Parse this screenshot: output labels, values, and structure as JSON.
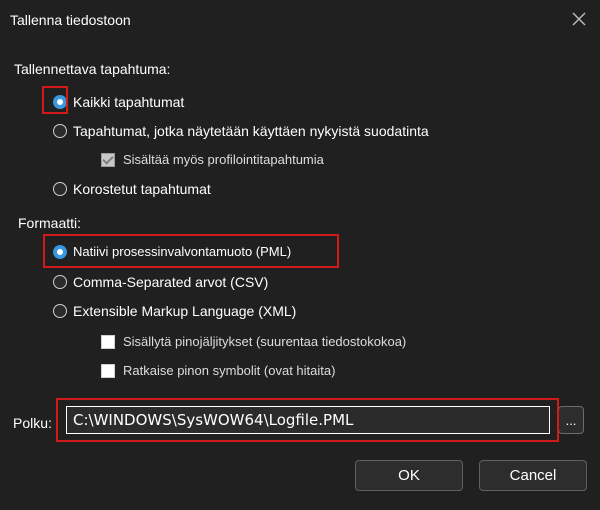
{
  "dialog": {
    "title": "Tallenna tiedostoon",
    "close_icon": "close-icon"
  },
  "events": {
    "label": "Tallennettava tapahtuma:",
    "options": [
      {
        "label": "Kaikki tapahtumat",
        "selected": true
      },
      {
        "label": "Tapahtumat, jotka näytetään käyttäen nykyistä suodatinta",
        "selected": false
      },
      {
        "label": "Korostetut tapahtumat",
        "selected": false
      }
    ],
    "profiling_checkbox": {
      "label": "Sisältää myös profilointitapahtumia",
      "checked": true,
      "enabled": false
    }
  },
  "format": {
    "label": "Formaatti:",
    "options": [
      {
        "label": "Natiivi prosessinvalvontamuoto (PML)",
        "selected": true
      },
      {
        "label": "Comma-Separated arvot (CSV)",
        "selected": false
      },
      {
        "label": "Extensible Markup Language (XML)",
        "selected": false
      }
    ],
    "xml_options": [
      {
        "label": "Sisällytä pinojäljitykset (suurentaa tiedostokokoa)",
        "checked": false
      },
      {
        "label": "Ratkaise pinon symbolit (ovat hitaita)",
        "checked": false
      }
    ]
  },
  "path": {
    "label": "Polku:",
    "value": "C:\\WINDOWS\\SysWOW64\\Logfile.PML",
    "browse_label": "..."
  },
  "buttons": {
    "ok": "OK",
    "cancel": "Cancel"
  },
  "colors": {
    "background": "#202020",
    "highlight": "#d11a1a",
    "accent": "#3a96dd"
  }
}
